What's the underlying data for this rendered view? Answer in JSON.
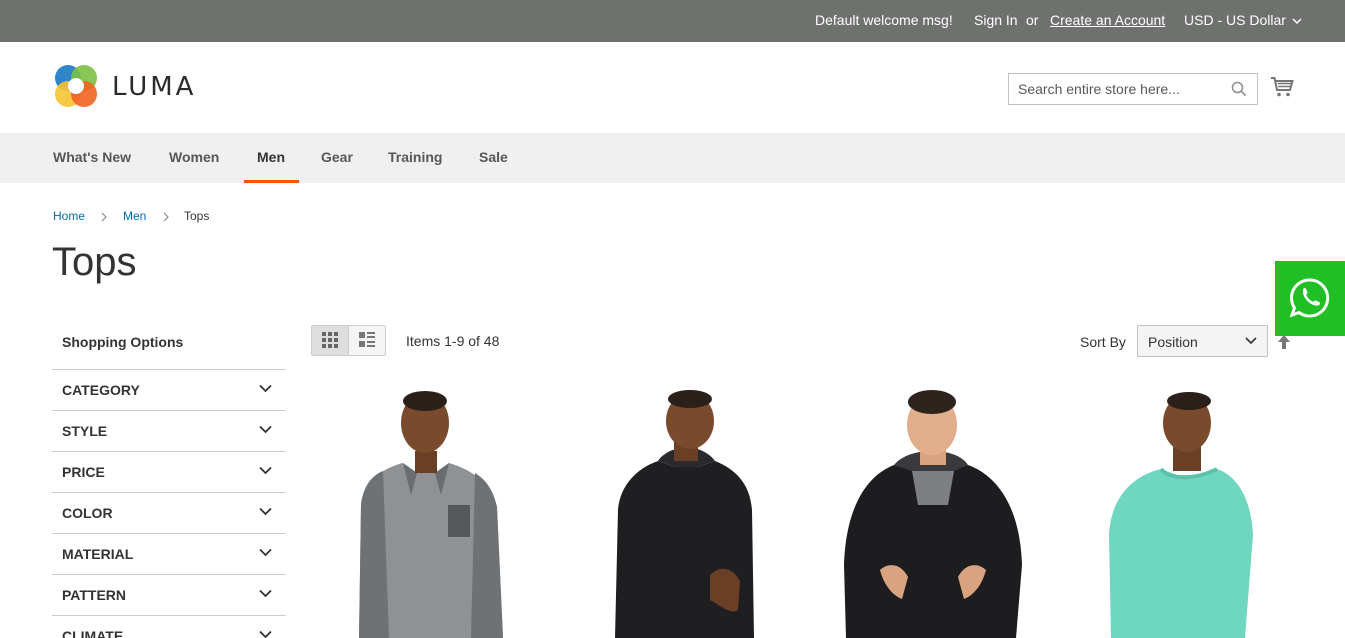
{
  "topbar": {
    "welcome": "Default welcome msg!",
    "sign_in": "Sign In",
    "or": "or",
    "create_account": "Create an Account",
    "currency": "USD - US Dollar"
  },
  "header": {
    "logo_text": "LUMA",
    "search_placeholder": "Search entire store here..."
  },
  "nav": {
    "items": [
      {
        "label": "What's New"
      },
      {
        "label": "Women"
      },
      {
        "label": "Men"
      },
      {
        "label": "Gear"
      },
      {
        "label": "Training"
      },
      {
        "label": "Sale"
      }
    ],
    "active": "Men"
  },
  "breadcrumb": {
    "home": "Home",
    "men": "Men",
    "current": "Tops",
    "separator": ">"
  },
  "page_title": "Tops",
  "sidebar": {
    "title": "Shopping Options",
    "filters": [
      "CATEGORY",
      "STYLE",
      "PRICE",
      "COLOR",
      "MATERIAL",
      "PATTERN",
      "CLIMATE"
    ]
  },
  "toolbar": {
    "amount": "Items 1-9 of 48",
    "sort_label": "Sort By",
    "sort_value": "Position"
  },
  "products": [
    {
      "color": "#8f9294",
      "sleeve": "#6f7275"
    },
    {
      "color": "#1f1f22",
      "sleeve": "#1f1f22"
    },
    {
      "color": "#1d1d20",
      "sleeve": "#1d1d20"
    },
    {
      "color": "#6fd6bf",
      "sleeve": "#6fd6bf"
    }
  ],
  "colors": {
    "topbar": "#6e716e",
    "nav_bg": "#f0f0f0",
    "accent": "#ff5501",
    "link": "#006bb4",
    "whatsapp": "#1fbf25"
  }
}
